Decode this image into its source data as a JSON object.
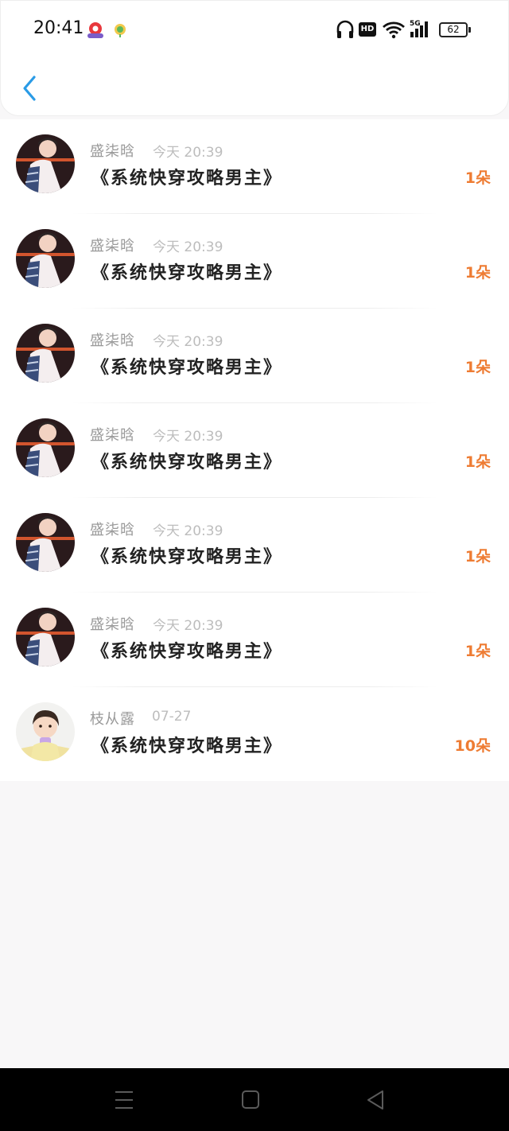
{
  "status_bar": {
    "time": "20:41",
    "hd_label": "HD",
    "network_label": "5G",
    "battery": "62",
    "icons": [
      "app-notification-icon",
      "app-notification-icon-2",
      "headphone-icon",
      "hd-icon",
      "wifi-icon",
      "signal-icon",
      "battery-icon"
    ]
  },
  "header": {
    "back_icon": "chevron-left-icon",
    "accent_color": "#2a9be6"
  },
  "gifts": [
    {
      "name": "盛柒晗",
      "time": "今天 20:39",
      "title": "《系统快穿攻略男主》",
      "amount": "1朵",
      "avatar": "avatar-boy-plaid"
    },
    {
      "name": "盛柒晗",
      "time": "今天 20:39",
      "title": "《系统快穿攻略男主》",
      "amount": "1朵",
      "avatar": "avatar-boy-plaid"
    },
    {
      "name": "盛柒晗",
      "time": "今天 20:39",
      "title": "《系统快穿攻略男主》",
      "amount": "1朵",
      "avatar": "avatar-boy-plaid"
    },
    {
      "name": "盛柒晗",
      "time": "今天 20:39",
      "title": "《系统快穿攻略男主》",
      "amount": "1朵",
      "avatar": "avatar-boy-plaid"
    },
    {
      "name": "盛柒晗",
      "time": "今天 20:39",
      "title": "《系统快穿攻略男主》",
      "amount": "1朵",
      "avatar": "avatar-boy-plaid"
    },
    {
      "name": "盛柒晗",
      "time": "今天 20:39",
      "title": "《系统快穿攻略男主》",
      "amount": "1朵",
      "avatar": "avatar-boy-plaid"
    },
    {
      "name": "枝从露",
      "time": "07-27",
      "title": "《系统快穿攻略男主》",
      "amount": "10朵",
      "avatar": "avatar-child"
    }
  ],
  "colors": {
    "amount": "#ee7c33",
    "name": "#9a9a9a",
    "time": "#bdbdbd",
    "title": "#222222",
    "background": "#f8f7f8"
  },
  "nav_bar": {
    "icons": [
      "menu-icon",
      "home-square-icon",
      "back-triangle-icon"
    ]
  }
}
